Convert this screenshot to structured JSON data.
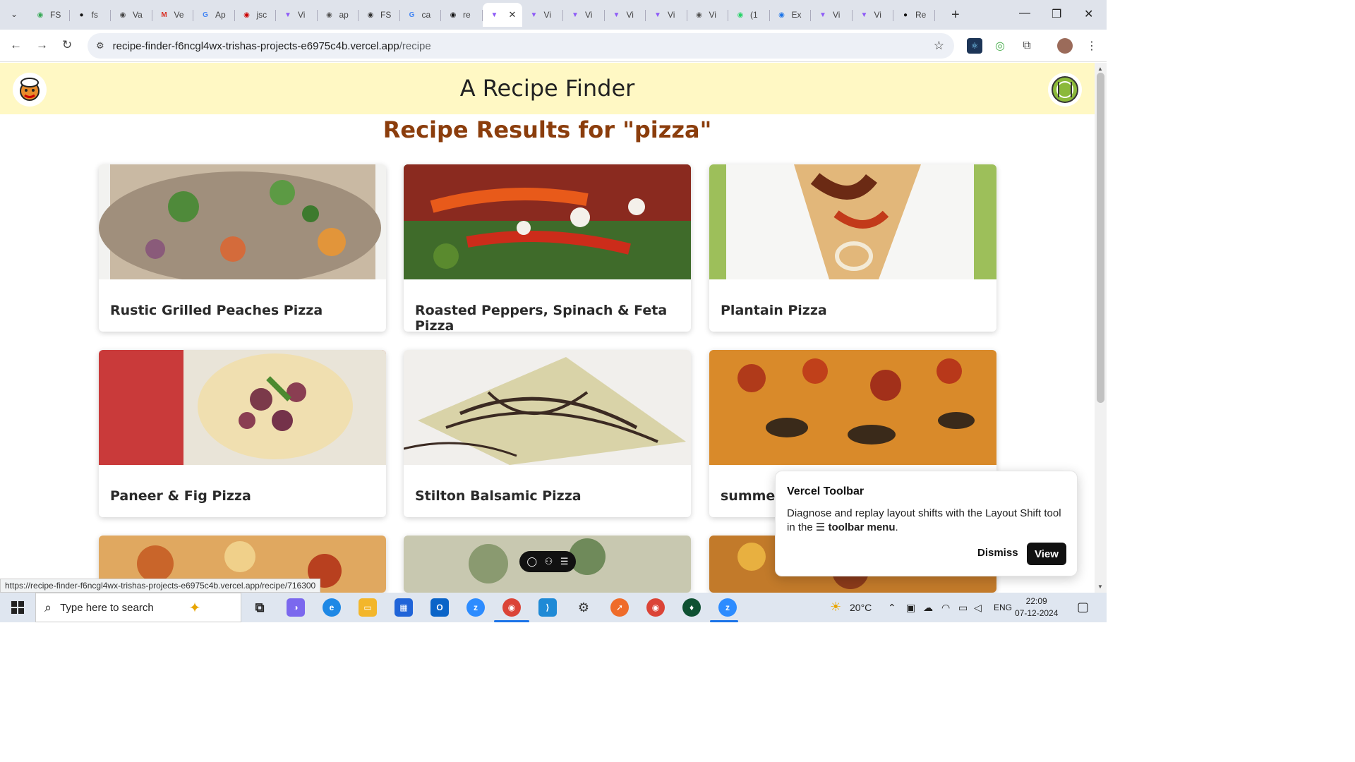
{
  "browser": {
    "tabs": [
      {
        "label": "FS",
        "icon": "sheets-icon",
        "color": "#34a853"
      },
      {
        "label": "fs",
        "icon": "github-icon",
        "color": "#111111"
      },
      {
        "label": "Va",
        "icon": "openai-icon",
        "color": "#444444"
      },
      {
        "label": "Ve",
        "icon": "gmail-icon",
        "color": "#d93025"
      },
      {
        "label": "Ap",
        "icon": "google-icon",
        "color": "#4285f4"
      },
      {
        "label": "jsc",
        "icon": "jsconsole-icon",
        "color": "#cc0000"
      },
      {
        "label": "Vi",
        "icon": "vite-icon",
        "color": "#8e5cf7"
      },
      {
        "label": "ap",
        "icon": "globe-icon",
        "color": "#555555"
      },
      {
        "label": "FS",
        "icon": "fs-icon",
        "color": "#333333"
      },
      {
        "label": "ca",
        "icon": "google-icon",
        "color": "#4285f4"
      },
      {
        "label": "re",
        "icon": "react-icon",
        "color": "#111111"
      },
      {
        "label": "",
        "icon": "vite-icon",
        "color": "#8e5cf7",
        "active": true
      },
      {
        "label": "Vi",
        "icon": "vite-icon",
        "color": "#8e5cf7"
      },
      {
        "label": "Vi",
        "icon": "vite-icon",
        "color": "#8e5cf7"
      },
      {
        "label": "Vi",
        "icon": "vite-icon",
        "color": "#8e5cf7"
      },
      {
        "label": "Vi",
        "icon": "vite-icon",
        "color": "#8e5cf7"
      },
      {
        "label": "Vi",
        "icon": "globe-icon",
        "color": "#555555"
      },
      {
        "label": "(1",
        "icon": "whatsapp-icon",
        "color": "#25d366"
      },
      {
        "label": "Ex",
        "icon": "extension-icon",
        "color": "#1a73e8"
      },
      {
        "label": "Vi",
        "icon": "vite-icon",
        "color": "#8e5cf7"
      },
      {
        "label": "Vi",
        "icon": "vite-icon",
        "color": "#8e5cf7"
      },
      {
        "label": "Re",
        "icon": "github-icon",
        "color": "#111111"
      }
    ],
    "url_domain": "recipe-finder-f6ncgl4wx-trishas-projects-e6975c4b.vercel.app",
    "url_path": "/recipe",
    "status_url": "https://recipe-finder-f6ncgl4wx-trishas-projects-e6975c4b.vercel.app/recipe/716300"
  },
  "site": {
    "title": "A Recipe Finder",
    "results_heading": "Recipe Results for \"pizza\"",
    "colors": {
      "header_bg": "#fff8c4",
      "heading": "#8b3d0c"
    }
  },
  "recipes": [
    {
      "name": "Rustic Grilled Peaches Pizza"
    },
    {
      "name": "Roasted Peppers, Spinach & Feta Pizza"
    },
    {
      "name": "Plantain Pizza"
    },
    {
      "name": "Paneer & Fig Pizza"
    },
    {
      "name": "Stilton Balsamic Pizza"
    },
    {
      "name": "summer v"
    }
  ],
  "vercel_toolbar": {
    "title": "Vercel Toolbar",
    "body_start": "Diagnose and replay layout shifts with the Layout Shift tool in the",
    "body_bold": "toolbar menu",
    "body_end": ".",
    "dismiss_label": "Dismiss",
    "view_label": "View"
  },
  "taskbar": {
    "search_placeholder": "Type here to search",
    "temperature": "20°C",
    "language": "ENG",
    "time": "22:09",
    "date": "07-12-2024"
  }
}
